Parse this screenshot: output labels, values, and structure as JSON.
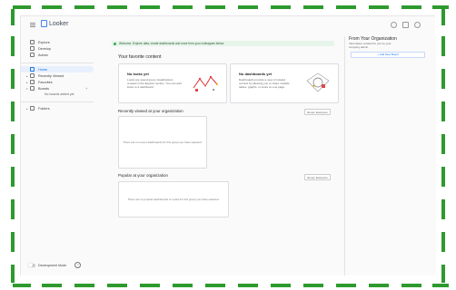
{
  "app": {
    "name": "Looker"
  },
  "sidebar": {
    "items": [
      {
        "label": "Explore",
        "icon": "compass-icon"
      },
      {
        "label": "Develop",
        "icon": "code-icon"
      },
      {
        "label": "Admin",
        "icon": "settings-icon"
      },
      {
        "label": "Home",
        "icon": "home-icon",
        "active": true
      },
      {
        "label": "Recently Viewed",
        "icon": "clock-icon"
      },
      {
        "label": "Favorites",
        "icon": "heart-icon"
      },
      {
        "label": "Boards",
        "icon": "boards-icon"
      },
      {
        "label": "Folders",
        "icon": "folder-icon"
      }
    ],
    "boards_empty": "No boards added yet",
    "dev_mode_label": "Development Mode",
    "help_label": "?"
  },
  "main": {
    "banner": "Welcome. Explore data, create dashboards and more from your colleagues below.",
    "favorites_heading": "Your favorite content",
    "looks_card": {
      "title": "No looks yet",
      "text": "Looks are saved query visualizations created in the Explore section. You can add looks to a dashboard."
    },
    "dashboards_card": {
      "title": "No dashboards yet",
      "text": "Dashboards provide a view of related content by allowing you to share multiple tables, graphs, or looks on one page."
    },
    "recent_heading": "Recently viewed at your organization",
    "recent_empty": "There are no recent dashboards for this group you have selected.",
    "recent_filter": "Group: Everyone",
    "popular_heading": "Popular at your organization",
    "popular_empty": "There are no popular dashboards or Looks for this group you have selected.",
    "popular_filter": "Group: Everyone"
  },
  "right_panel": {
    "title": "From Your Organization",
    "text": "Information curated for you by your company admin.",
    "add_button": "+ Add New Board"
  },
  "colors": {
    "frame_dash": "#2e9a2e",
    "accent": "#1a73e8",
    "banner_bg": "#e6f4ea"
  }
}
